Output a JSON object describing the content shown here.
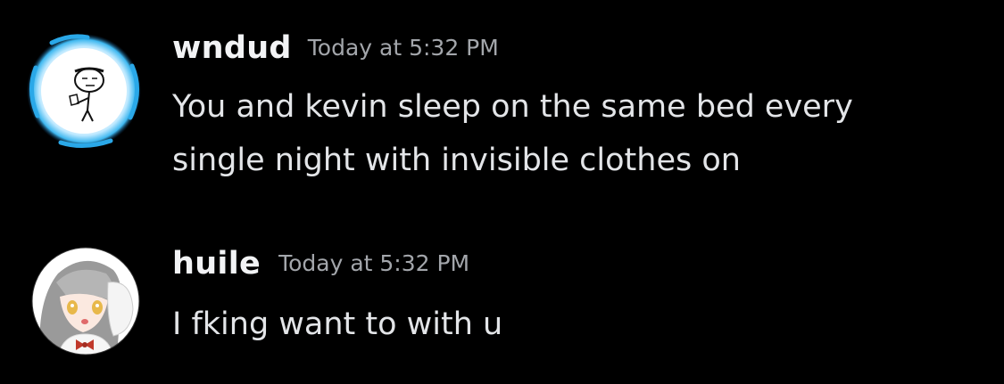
{
  "messages": [
    {
      "author": "wndud",
      "timestamp": "Today at 5:32 PM",
      "lines": [
        "You and kevin sleep on the same bed every",
        "single night with invisible clothes on"
      ]
    },
    {
      "author": "huile",
      "timestamp": "Today at 5:32 PM",
      "lines": [
        "I fking want to with u"
      ]
    }
  ],
  "colors": {
    "background": "#000000",
    "username": "#f2f3f5",
    "timestamp": "#a3a6ab",
    "text": "#e3e5e8",
    "avatar_glow": "#3fb8f0"
  }
}
